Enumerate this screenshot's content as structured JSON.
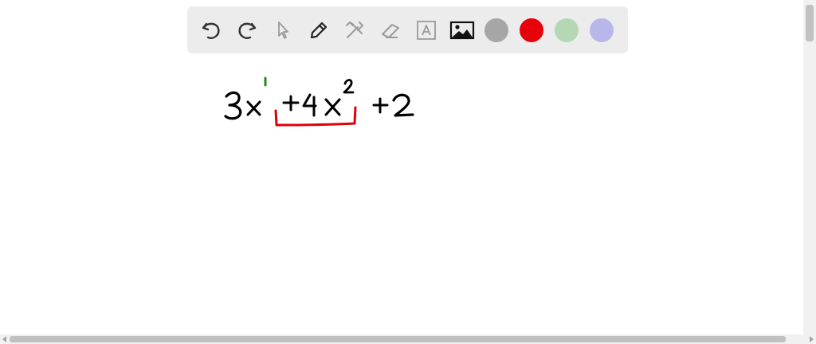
{
  "toolbar": {
    "tools": [
      {
        "name": "undo-icon"
      },
      {
        "name": "redo-icon"
      },
      {
        "name": "pointer-icon"
      },
      {
        "name": "pencil-icon"
      },
      {
        "name": "tools-icon"
      },
      {
        "name": "eraser-icon"
      },
      {
        "name": "text-box-icon"
      },
      {
        "name": "image-icon"
      }
    ],
    "colors": [
      "#a6a6a6",
      "#e8000b",
      "#b3d8b3",
      "#b9b6ea"
    ]
  },
  "canvas": {
    "expression": {
      "term1": "3x",
      "exponent1": "1",
      "term2": "+4x",
      "exponent2": "2",
      "term3": "+2"
    },
    "colors": {
      "ink": "#000000",
      "exponent_mark": "#1a8f1a",
      "bracket": "#e0000b"
    }
  }
}
